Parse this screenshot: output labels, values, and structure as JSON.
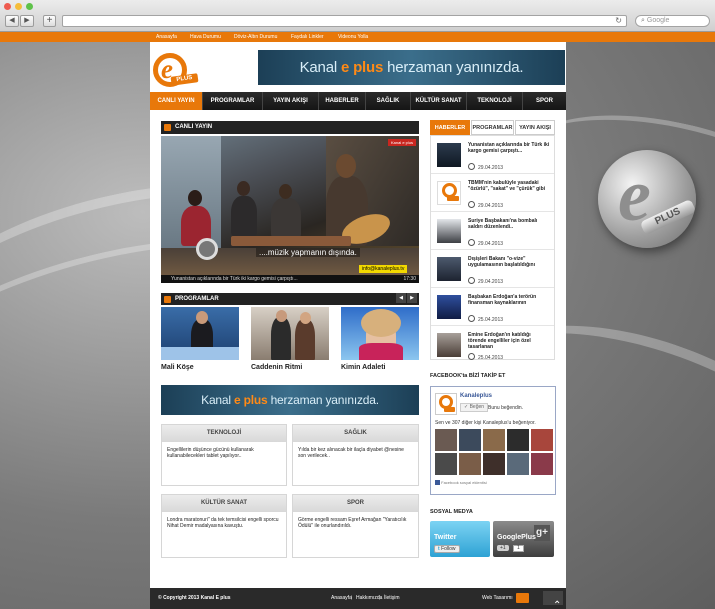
{
  "browser": {
    "back_glyph": "◀",
    "forward_glyph": "▶",
    "newtab_glyph": "+",
    "reload_glyph": "↻",
    "search_placeholder": "Google",
    "colors": {
      "close": "#ee5b4f",
      "minimize": "#f5bd3a",
      "maximize": "#5fc24a"
    }
  },
  "topbar": {
    "links": [
      "Anasayfa",
      "Hava Durumu",
      "Döviz-Altın Durumu",
      "Faydalı Linkler",
      "Videonu Yolla"
    ]
  },
  "logo": {
    "letter": "e",
    "tag": "PLUS"
  },
  "banner_top": {
    "pre": "Kanal ",
    "brand": "e plus",
    "post": " herzaman yanınızda."
  },
  "nav": {
    "items": [
      "CANLI YAYIN",
      "PROGRAMLAR",
      "YAYIN AKIŞI",
      "HABERLER",
      "SAĞLIK",
      "KÜLTÜR SANAT",
      "TEKNOLOJİ",
      "SPOR"
    ]
  },
  "live": {
    "heading": "CANLI YAYIN",
    "overlay_channel": "Kanal e plus",
    "caption": "....müzik yapmanın dışında.",
    "site": "info@kanaleplus.tv",
    "time": "17:30",
    "ticker": "Yunanistan açıklarında bir Türk iki kargo gemisi çarpıştı..."
  },
  "programs": {
    "heading": "PROGRAMLAR",
    "prev_glyph": "◀",
    "next_glyph": "▶",
    "items": [
      {
        "title": "Mali Köşe"
      },
      {
        "title": "Caddenin Ritmi"
      },
      {
        "title": "Kimin Adaleti"
      }
    ]
  },
  "banner_mid": {
    "pre": "Kanal ",
    "brand": "e plus",
    "post": " herzaman yanınızda."
  },
  "categories": [
    {
      "title": "TEKNOLOJİ",
      "text": "Engellilerin düşünce gücünü kullanarak kullanabilecekleri tablet yapılıyor.."
    },
    {
      "title": "SAĞLIK",
      "text": "Yılda bir kez alınacak bir ilaçla diyabet @nesine son verilecek.."
    },
    {
      "title": "KÜLTÜR SANAT",
      "text": "Londra maratonuri\" da tek temsilcisi engelli sporcu Nihat Demir madalyasına kavuştu."
    },
    {
      "title": "SPOR",
      "text": "Görme engelli ressam Eşref Armağan \"Yaratıcılık Ödülü\" ile onurlandırıldı."
    }
  ],
  "sidebar": {
    "tabs": [
      "HABERLER",
      "PROGRAMLAR",
      "YAYIN AKIŞI"
    ],
    "news": [
      {
        "title": "Yunanistan açıklarında bir Türk iki kargo gemisi çarpıştı...",
        "date": "29.04.2013"
      },
      {
        "title": "TBMM'nin kabulüyle yasadaki \"özürlü\", \"sakat\" ve \"çürük\" gibi",
        "date": "29.04.2013"
      },
      {
        "title": "Suriye Başbakanı'na bombalı saldırı düzenlendi..",
        "date": "29.04.2013"
      },
      {
        "title": "Dışişleri Bakanı \"o-vize\" uygulamasının başlatıldığını",
        "date": "29.04.2013"
      },
      {
        "title": "Başbakan Erdoğan'a terörün finansman kaynaklarının",
        "date": "25.04.2013"
      },
      {
        "title": "Emine Erdoğan'ın katıldığı törende engelliler için özel tasarlanan",
        "date": "25.04.2013"
      }
    ],
    "fb_heading": "FACEBOOK'ta BİZİ TAKİP ET",
    "fb": {
      "page_name": "Kanaleplus",
      "like_label": "Beğen",
      "like_note": "Bunu beğendin.",
      "count_text": "Sen ve 307 diğer kişi Kanaleplus'u beğeniyor.",
      "plugin_text": "Facebook sosyal eklentisi"
    },
    "social_heading": "SOSYAL MEDYA",
    "twitter": {
      "label": "Twitter",
      "follow": "Follow"
    },
    "gplus": {
      "label": "GooglePlus",
      "plus_glyph": "g+",
      "share": "+1",
      "count": "1"
    }
  },
  "footer": {
    "copyright": "© Copyright 2013 Kanal E plus",
    "links": [
      "Anasayfa",
      "Hakkımızda",
      "İletişim"
    ],
    "sep": "|",
    "credit": "Web Tasarımı",
    "top_glyph": "⌃"
  }
}
